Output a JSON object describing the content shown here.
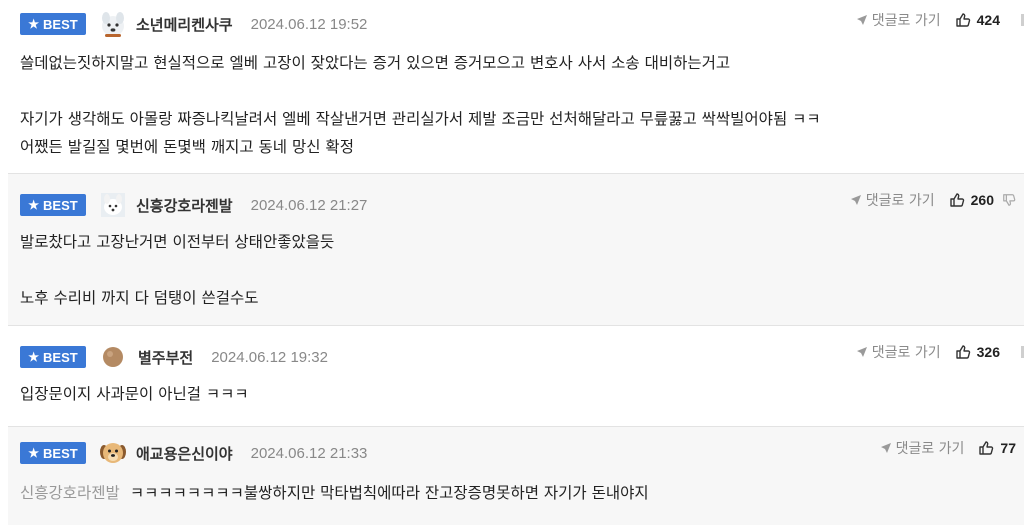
{
  "badge_label": "BEST",
  "reply_link_label": "댓글로 가기",
  "comments": [
    {
      "nickname": "소년메리켄사쿠",
      "date": "2024.06.12 19:52",
      "likes": "424",
      "avatar": "white-puppy-icon",
      "lines": [
        "쓸데없는짓하지말고 현실적으로 엘베 고장이 잦았다는 증거 있으면 증거모으고 변호사 사서 소송 대비하는거고",
        "",
        "자기가 생각해도 아몰랑 짜증나킥날려서 엘베 작살낸거면 관리실가서 제발 조금만 선처해달라고 무릎꿇고 싹싹빌어야됨 ㅋㅋ",
        "어쨌든 발길질 몇번에 돈몇백 깨지고 동네 망신 확정"
      ]
    },
    {
      "nickname": "신흥강호라젠발",
      "date": "2024.06.12 21:27",
      "likes": "260",
      "avatar": "white-dog-icon",
      "lines": [
        "발로찼다고 고장난거면 이전부터 상태안좋았을듯",
        "",
        "노후 수리비 까지 다 덤탱이 쓴걸수도"
      ]
    },
    {
      "nickname": "별주부전",
      "date": "2024.06.12 19:32",
      "likes": "326",
      "avatar": "brown-ball-icon",
      "lines": [
        "입장문이지 사과문이 아닌걸 ㅋㅋㅋ"
      ]
    },
    {
      "nickname": "애교용은신이야",
      "date": "2024.06.12 21:33",
      "likes": "77",
      "avatar": "puppy-face-icon",
      "mention": "신흥강호라젠발",
      "lines": [
        "ㅋㅋㅋㅋㅋㅋㅋㅋ불쌍하지만 막타법칙에따라 잔고장증명못하면 자기가 돈내야지"
      ]
    }
  ],
  "colors": {
    "badge": "#3a78d6",
    "alt_row": "#f7f7f7",
    "date": "#888888",
    "mention": "#999999"
  }
}
